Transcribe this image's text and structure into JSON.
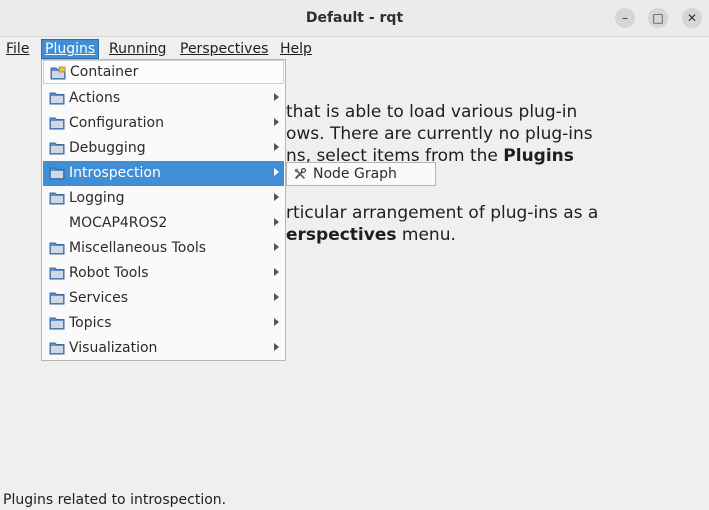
{
  "window": {
    "title": "Default - rqt",
    "minimize_glyph": "–",
    "maximize_glyph": "□",
    "close_glyph": "✕"
  },
  "menubar": {
    "items": [
      "File",
      "Plugins",
      "Running",
      "Perspectives",
      "Help"
    ],
    "active": "Plugins"
  },
  "background_text": {
    "line1": "that is able to load various plug-in",
    "line2": "ows. There are currently no plug-ins",
    "line3_pre": "ns, select items from the ",
    "line3_bold": "Plugins",
    "line4": "rticular arrangement of plug-ins as a",
    "line5_bold": "erspectives",
    "line5_post": " menu."
  },
  "plugins_menu": {
    "items": [
      {
        "label": "Container",
        "icon": "container-icon",
        "submenu": false
      },
      {
        "label": "Actions",
        "icon": "folder-icon",
        "submenu": true
      },
      {
        "label": "Configuration",
        "icon": "folder-icon",
        "submenu": true
      },
      {
        "label": "Debugging",
        "icon": "folder-icon",
        "submenu": true
      },
      {
        "label": "Introspection",
        "icon": "folder-icon",
        "submenu": true
      },
      {
        "label": "Logging",
        "icon": "folder-icon",
        "submenu": true
      },
      {
        "label": "MOCAP4ROS2",
        "icon": "",
        "submenu": true
      },
      {
        "label": "Miscellaneous Tools",
        "icon": "folder-icon",
        "submenu": true
      },
      {
        "label": "Robot Tools",
        "icon": "folder-icon",
        "submenu": true
      },
      {
        "label": "Services",
        "icon": "folder-icon",
        "submenu": true
      },
      {
        "label": "Topics",
        "icon": "folder-icon",
        "submenu": true
      },
      {
        "label": "Visualization",
        "icon": "folder-icon",
        "submenu": true
      }
    ],
    "highlighted": "Introspection"
  },
  "introspection_submenu": {
    "items": [
      {
        "label": "Node Graph",
        "icon": "tools-icon"
      }
    ]
  },
  "statusbar": {
    "text": "Plugins related to introspection."
  },
  "colors": {
    "highlight": "#3f8ed6",
    "background": "#efefef"
  }
}
